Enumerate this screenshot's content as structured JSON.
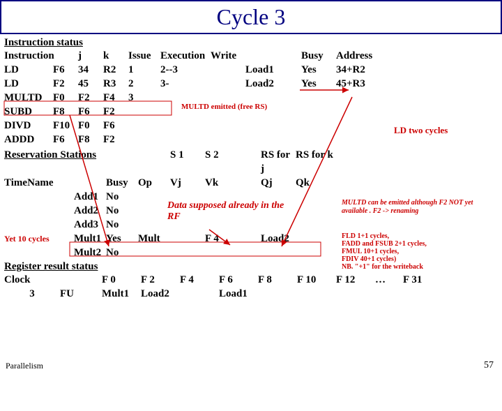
{
  "title": "Cycle 3",
  "instruction_status": {
    "heading": "Instruction status",
    "headers": {
      "inst": "Instruction",
      "j": "j",
      "k": "k",
      "issue": "Issue",
      "exec": "Execution",
      "write": "Write",
      "busy": "Busy",
      "addr": "Address"
    },
    "rows": [
      {
        "inst": "LD",
        "d": "F6",
        "j": "34",
        "k": "R2",
        "issue": "1",
        "exec": "2--3",
        "write": "",
        "unit": "Load1",
        "busy": "Yes",
        "addr": "34+R2"
      },
      {
        "inst": "LD",
        "d": "F2",
        "j": "45",
        "k": "R3",
        "issue": "2",
        "exec": "3-",
        "write": "",
        "unit": "Load2",
        "busy": "Yes",
        "addr": "45+R3"
      },
      {
        "inst": "MULTD",
        "d": "F0",
        "j": "F2",
        "k": "F4",
        "issue": "3",
        "exec": "",
        "write": "",
        "unit": "",
        "busy": "",
        "addr": ""
      },
      {
        "inst": "SUBD",
        "d": "F8",
        "j": "F6",
        "k": "F2",
        "issue": "",
        "exec": "",
        "write": "",
        "unit": "",
        "busy": "",
        "addr": ""
      },
      {
        "inst": "DIVD",
        "d": "F10",
        "j": "F0",
        "k": "F6",
        "issue": "",
        "exec": "",
        "write": "",
        "unit": "",
        "busy": "",
        "addr": ""
      },
      {
        "inst": "ADDD",
        "d": "F6",
        "j": "F8",
        "k": "F2",
        "issue": "",
        "exec": "",
        "write": "",
        "unit": "",
        "busy": "",
        "addr": ""
      }
    ]
  },
  "reservation_stations": {
    "heading": "Reservation Stations",
    "headers": {
      "time": "Time",
      "name": "Name",
      "busy": "Busy",
      "op": "Op",
      "s1": "S 1",
      "s2": "S 2",
      "rsj": "RS for j",
      "rsk": "RS for k",
      "vj": "Vj",
      "vk": "Vk",
      "qj": "Qj",
      "qk": "Qk"
    },
    "rows": [
      {
        "name": "Add1",
        "busy": "No",
        "op": "",
        "vj": "",
        "vk": "",
        "qj": "",
        "qk": ""
      },
      {
        "name": "Add2",
        "busy": "No",
        "op": "",
        "vj": "",
        "vk": "",
        "qj": "",
        "qk": ""
      },
      {
        "name": "Add3",
        "busy": "No",
        "op": "",
        "vj": "",
        "vk": "",
        "qj": "",
        "qk": ""
      },
      {
        "name": "Mult1",
        "busy": "Yes",
        "op": "Mult",
        "vj": "",
        "vk": "F 4",
        "qj": "Load2",
        "qk": ""
      },
      {
        "name": "Mult2",
        "busy": "No",
        "op": "",
        "vj": "",
        "vk": "",
        "qj": "",
        "qk": ""
      }
    ]
  },
  "register_status": {
    "heading": "Register result status",
    "clock_label": "Clock",
    "clock_value": "3",
    "fu_label": "FU",
    "regs": [
      "F 0",
      "F 2",
      "F 4",
      "F 6",
      "F 8",
      "F 10",
      "F 12",
      "…",
      "F 31"
    ],
    "fu": [
      "Mult1",
      "Load2",
      "",
      "Load1",
      "",
      "",
      "",
      "",
      ""
    ]
  },
  "annotations": {
    "multd_emitted": "MULTD emitted  (free RS)",
    "ld_two_cycles": "LD two cycles",
    "data_supposed": "Data supposed already in the RF",
    "yet10": "Yet 10 cycles",
    "multd_f2": "MULTD can be emitted although F2 NOT yet available . F2 -> renaming",
    "latencies": "FLD 1+1 cycles,\nFADD and FSUB 2+1 cycles,\nFMUL 10+1 cycles,\nFDIV 40+1 cycles)\nNB. \"+1\" for the writeback"
  },
  "footer": {
    "left": "Parallelism",
    "right": "57"
  }
}
